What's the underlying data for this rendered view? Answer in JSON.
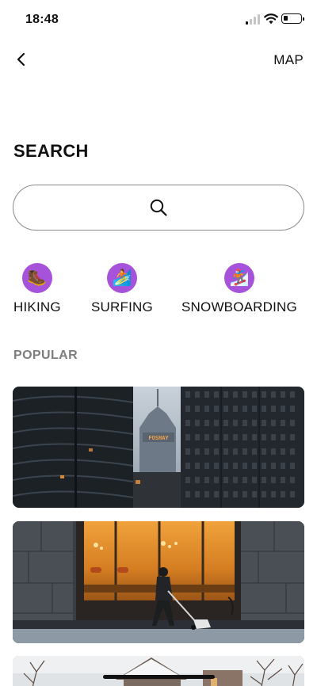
{
  "status_bar": {
    "time": "18:48"
  },
  "nav": {
    "map_label": "MAP"
  },
  "page": {
    "title": "SEARCH"
  },
  "search": {
    "value": "",
    "placeholder": ""
  },
  "categories": [
    {
      "label": "HIKING",
      "icon": "hiking-boot-icon",
      "glyph": "🥾"
    },
    {
      "label": "SURFING",
      "icon": "surfer-icon",
      "glyph": "🏄"
    },
    {
      "label": "SNOWBOARDING",
      "icon": "snowboarder-icon",
      "glyph": "🏂"
    }
  ],
  "popular": {
    "label": "POPULAR"
  },
  "colors": {
    "accent": "#a652db",
    "section_label": "#7d7d7d",
    "text": "#111111"
  },
  "cards": [
    {
      "name": "city-skyline-photo",
      "sign": "FOSHAY"
    },
    {
      "name": "storefront-night-photo"
    },
    {
      "name": "snowy-street-photo"
    }
  ]
}
